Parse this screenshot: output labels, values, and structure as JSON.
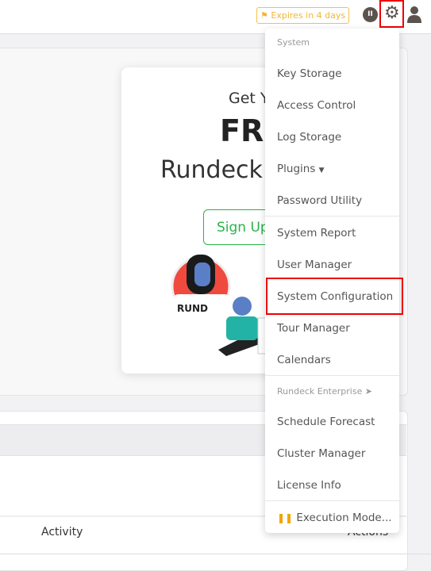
{
  "header": {
    "expires_badge": "Expires in 4 days",
    "icons": [
      "flag-icon",
      "pause-circle-icon",
      "gear-icon",
      "user-icon"
    ]
  },
  "promo": {
    "line1": "Get Y",
    "line2": "FR",
    "line3": "Rundeck",
    "signup": "Sign Up",
    "sticker_text": "RUND"
  },
  "table": {
    "activity_header": "Activity",
    "actions_header": "Actions"
  },
  "menu": {
    "system_header": "System",
    "items1": [
      "Key Storage",
      "Access Control",
      "Log Storage",
      "Plugins",
      "Password Utility"
    ],
    "items2": [
      "System Report",
      "User Manager",
      "System Configuration",
      "Tour Manager",
      "Calendars"
    ],
    "enterprise_header": "Rundeck Enterprise ➤",
    "items3": [
      "Schedule Forecast",
      "Cluster Manager",
      "License Info"
    ],
    "execution_mode": "Execution Mode..."
  },
  "colors": {
    "highlight": "#e00000",
    "badge": "#f2b632",
    "signup": "#2bb34a"
  }
}
